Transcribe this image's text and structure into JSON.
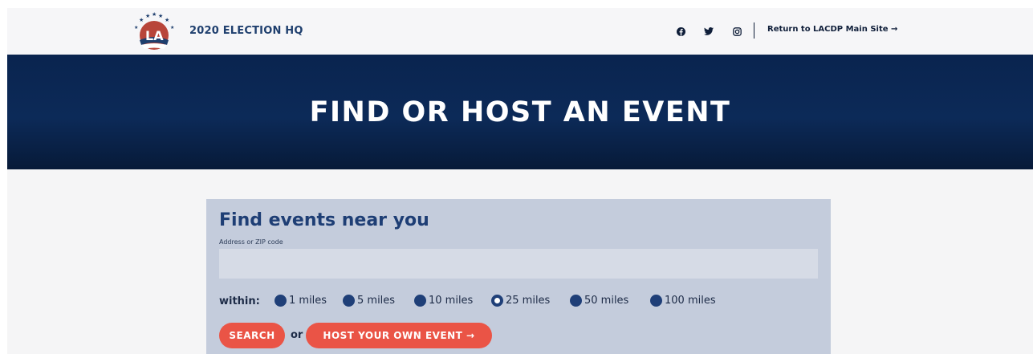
{
  "header": {
    "brand_title": "2020 ELECTION HQ",
    "social_icons": [
      "facebook-icon",
      "twitter-icon",
      "instagram-icon"
    ],
    "return_link": "Return to LACDP Main Site →"
  },
  "hero": {
    "title": "FIND OR HOST AN EVENT"
  },
  "search_panel": {
    "heading": "Find events near you",
    "address_label": "Address or ZIP code",
    "address_value": "",
    "within_label": "within:",
    "radius_options": [
      "1 miles",
      "5 miles",
      "10 miles",
      "25 miles",
      "50 miles",
      "100 miles"
    ],
    "selected_radius": "25 miles",
    "search_button": "SEARCH",
    "or_text": "or",
    "host_button": "HOST YOUR OWN EVENT →"
  },
  "colors": {
    "navy": "#0c2a58",
    "panel": "#c4ccdc",
    "accent_red": "#ea5446",
    "brand_blue": "#1f3f6e"
  }
}
